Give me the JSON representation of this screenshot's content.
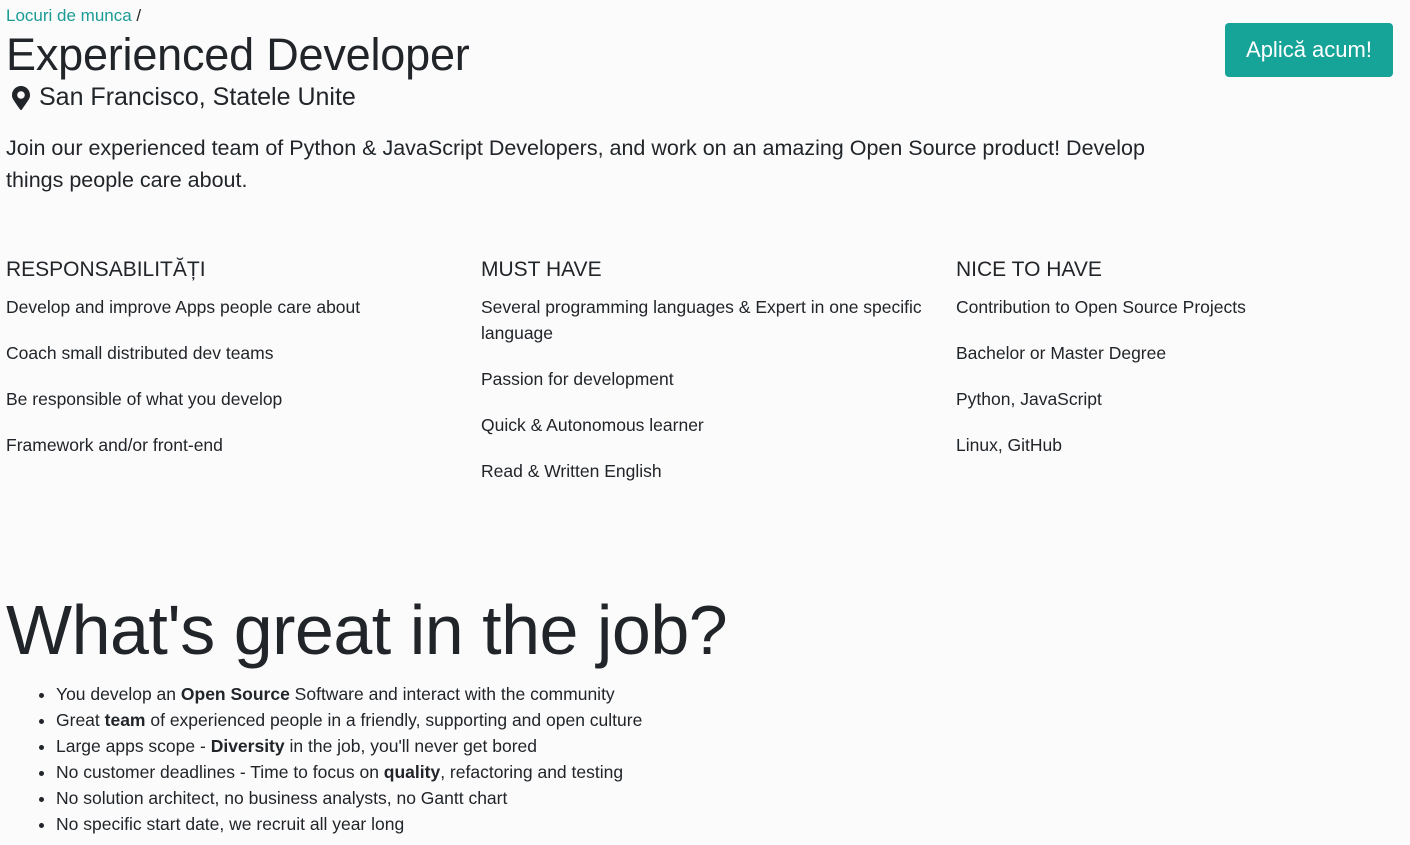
{
  "breadcrumb": {
    "link": "Locuri de munca",
    "separator": "/"
  },
  "job": {
    "title": "Experienced Developer",
    "location": "San Francisco, Statele Unite",
    "location_icon": "map-marker-icon",
    "intro": "Join our experienced team of Python & JavaScript Developers, and work on an amazing Open Source product! Develop things people care about."
  },
  "apply_button": {
    "label": "Aplică acum!",
    "color": "#16a398"
  },
  "columns": [
    {
      "heading": "Responsabilități",
      "items": [
        "Develop and improve Apps people care about",
        "Coach small distributed dev teams",
        "Be responsible of what you develop",
        "Framework and/or front-end"
      ]
    },
    {
      "heading": "Must Have",
      "items": [
        "Several programming languages & Expert in one specific language",
        "Passion for development",
        "Quick & Autonomous learner",
        "Read & Written English"
      ]
    },
    {
      "heading": "Nice to have",
      "items": [
        "Contribution to Open Source Projects",
        "Bachelor or Master Degree",
        "Python, JavaScript",
        "Linux, GitHub"
      ]
    }
  ],
  "great": {
    "title": "What's great in the job?",
    "items": [
      {
        "before": "You develop an ",
        "bold": "Open Source",
        "after": " Software and interact with the community"
      },
      {
        "before": "Great ",
        "bold": "team",
        "after": " of experienced people in a friendly, supporting and open culture"
      },
      {
        "before": "Large apps scope - ",
        "bold": "Diversity",
        "after": " in the job, you'll never get bored"
      },
      {
        "before": "No customer deadlines - Time to focus on ",
        "bold": "quality",
        "after": ", refactoring and testing"
      },
      {
        "before": "No solution architect, no business analysts, no Gantt chart",
        "bold": "",
        "after": ""
      },
      {
        "before": "No specific start date, we recruit all year long",
        "bold": "",
        "after": ""
      }
    ]
  }
}
